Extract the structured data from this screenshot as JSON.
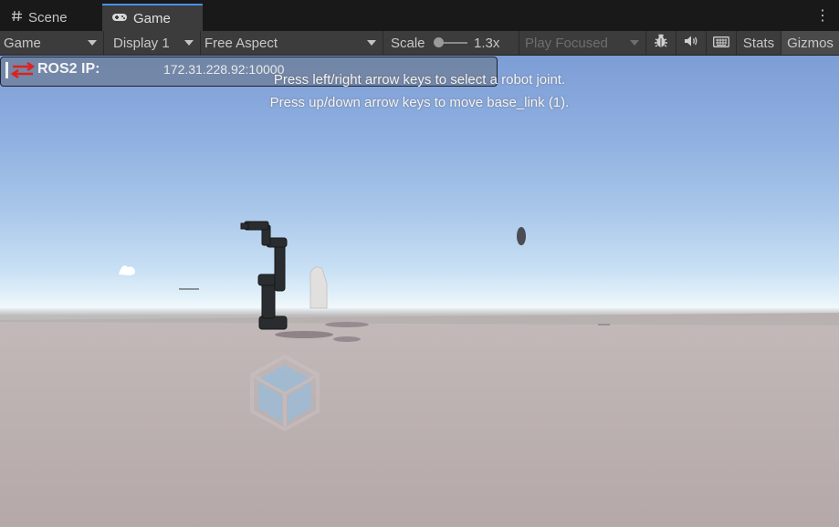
{
  "tabs": [
    {
      "label": "Scene",
      "icon": "grid-icon",
      "active": false
    },
    {
      "label": "Game",
      "icon": "gamepad-icon",
      "active": true
    }
  ],
  "toolbar": {
    "view_mode": "Game",
    "display": "Display 1",
    "aspect": "Free Aspect",
    "scale_label": "Scale",
    "scale_value": "1.3x",
    "play_mode": "Play Focused",
    "stats_label": "Stats",
    "gizmos_label": "Gizmos"
  },
  "overlay": {
    "ros_label": "ROS2 IP:",
    "ros_ip": "172.31.228.92:10000",
    "hint_line1": "Press left/right arrow keys to select a robot joint.",
    "hint_line2": "Press up/down arrow keys to move base_link (1)."
  },
  "colors": {
    "accent": "#4c8ef0",
    "toolbar_bg": "#3c3c3c",
    "sky_top": "#7d9dd6",
    "ground": "#b5a8a8",
    "ros_arrow": "#e0201c"
  }
}
